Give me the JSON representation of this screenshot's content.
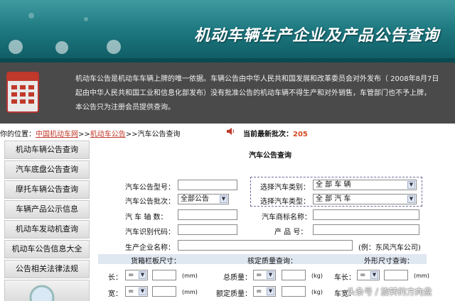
{
  "header": {
    "title": "机动车辆生产企业及产品公告查询"
  },
  "notice": {
    "line1": "机动车公告是机动车车辆上牌的唯一依据。车辆公告由中华人民共和国发展和改革委员会对外发布（ 2008年8月7日",
    "line2": "起由中华人民共和国工业和信息化部发布）没有批准公告的机动车辆不得生产和对外销售，车管部门也不予上牌，",
    "line3": "本公告只为注册会员提供查询。"
  },
  "breadcrumb": {
    "prefix": "你的位置：",
    "link1": "中国机动车网",
    "sep1": ">>",
    "link2": "机动车公告",
    "sep2": ">>",
    "current": "汽车公告查询",
    "batch_label": "当前最新批次：",
    "batch_value": "205"
  },
  "sidebar": {
    "items": [
      {
        "label": "机动车辆公告查询"
      },
      {
        "label": "汽车底盘公告查询"
      },
      {
        "label": "摩托车辆公告查询"
      },
      {
        "label": "车辆产品公示信息"
      },
      {
        "label": "机动车发动机查询"
      },
      {
        "label": "机动车公告信息大全"
      },
      {
        "label": "公告相关法律法规"
      }
    ]
  },
  "form": {
    "title": "汽车公告查询",
    "model_label": "汽车公告型号：",
    "batch_label": "汽车公告批次：",
    "batch_value": "全部公告",
    "axles_label": "汽  车  轴  数：",
    "vin_label": "汽车识别代码：",
    "maker_label": "生产企业名称：",
    "maker_hint": "(例：东风汽车公司)",
    "category_label": "选择汽车类别：",
    "category_value": "全 部 车 辆",
    "type_label": "选择汽车类型：",
    "type_value": "全 部 汽 车",
    "brand_label": "汽车商标名称：",
    "product_label": "产    品    号："
  },
  "section": {
    "cargo_box": "货箱栏板尺寸：",
    "mass": "核定质量查询：",
    "outer": "外形尺寸查询："
  },
  "row1": {
    "length_label": "长：",
    "op": "=",
    "unit_mm": "(mm)",
    "total_mass_label": "总质量：",
    "unit_kg": "(kg)",
    "car_length_label": "车长："
  },
  "row2": {
    "width_label": "宽：",
    "op": "=",
    "unit_mm": "(mm)",
    "rated_mass_label": "额定质量：",
    "unit_kg": "(kg)",
    "car_width_label": "车宽："
  },
  "watermark": "头条号 / 旋转的方向盘"
}
